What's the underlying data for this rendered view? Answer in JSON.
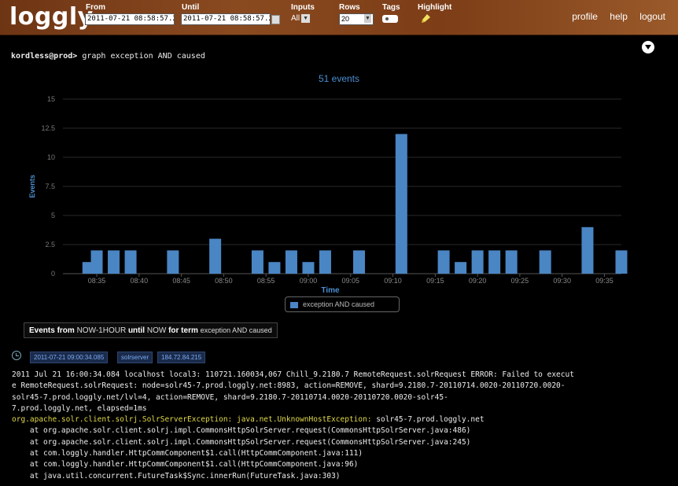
{
  "header": {
    "logo": "loggly",
    "from_label": "From",
    "from_value": "2011-07-21 08:58:57.22",
    "until_label": "Until",
    "until_value": "2011-07-21 08:58:57.22",
    "inputs_label": "Inputs",
    "inputs_value": "All",
    "rows_label": "Rows",
    "rows_value": "20",
    "tags_label": "Tags",
    "highlight_label": "Highlight",
    "links": [
      "profile",
      "help",
      "logout"
    ]
  },
  "console": {
    "prompt_user": "kordless@prod>",
    "command": "graph exception AND caused"
  },
  "chart_data": {
    "type": "bar",
    "title": "51 events",
    "xlabel": "Time",
    "ylabel": "Events",
    "ylim": [
      0,
      15
    ],
    "yticks": [
      "0",
      "2.5",
      "5",
      "7.5",
      "10",
      "12.5",
      "15"
    ],
    "xticks": [
      "08:35",
      "08:40",
      "08:45",
      "08:50",
      "08:55",
      "09:00",
      "09:05",
      "09:10",
      "09:15",
      "09:20",
      "09:25",
      "09:30",
      "09:35"
    ],
    "x_minutes": [
      34,
      35,
      36,
      37,
      39,
      41,
      43,
      44,
      45,
      46,
      47,
      49,
      52,
      53,
      55,
      56,
      57,
      59,
      60,
      61,
      62,
      63,
      65,
      67,
      68
    ],
    "values": [
      1,
      2,
      2,
      2,
      2,
      3,
      2,
      1,
      2,
      1,
      2,
      2,
      12,
      2,
      1,
      2,
      2,
      2,
      2,
      4,
      2,
      0,
      0,
      0,
      0
    ],
    "bars": [
      {
        "time": "08:34",
        "value": 1
      },
      {
        "time": "08:35",
        "value": 2
      },
      {
        "time": "08:37",
        "value": 2
      },
      {
        "time": "08:39",
        "value": 2
      },
      {
        "time": "08:44",
        "value": 2
      },
      {
        "time": "08:49",
        "value": 3
      },
      {
        "time": "08:54",
        "value": 2
      },
      {
        "time": "08:56",
        "value": 1
      },
      {
        "time": "08:58",
        "value": 2
      },
      {
        "time": "09:00",
        "value": 1
      },
      {
        "time": "09:02",
        "value": 2
      },
      {
        "time": "09:06",
        "value": 2
      },
      {
        "time": "09:11",
        "value": 12
      },
      {
        "time": "09:16",
        "value": 2
      },
      {
        "time": "09:18",
        "value": 1
      },
      {
        "time": "09:20",
        "value": 2
      },
      {
        "time": "09:22",
        "value": 2
      },
      {
        "time": "09:24",
        "value": 2
      },
      {
        "time": "09:28",
        "value": 2
      },
      {
        "time": "09:33",
        "value": 4
      },
      {
        "time": "09:37",
        "value": 2
      }
    ],
    "legend": "exception AND caused",
    "color": "#4a85c4",
    "grid": true
  },
  "summary": {
    "p1": "Events from",
    "p2": "NOW-1HOUR",
    "p3": "until",
    "p4": "NOW",
    "p5": "for term",
    "p6": "exception AND caused"
  },
  "event": {
    "timestamp": "2011-07-21 09:00:34.085",
    "source": "solrserver",
    "ip": "184.72.84.215",
    "lines": [
      "2011 Jul 21 16:00:34.084 localhost local3: 110721.160034,067 Chill_9.2180.7 RemoteRequest.solrRequest ERROR: Failed to execut",
      "e RemoteRequest.solrRequest: node=solr45-7.prod.loggly.net:8983, action=REMOVE, shard=9.2180.7-20110714.0020-20110720.0020-",
      "solr45-7.prod.loggly.net/lvl=4, action=REMOVE, shard=9.2180.7-20110714.0020-20110720.0020-solr45-",
      "7.prod.loggly.net, elapsed=1ms"
    ],
    "exception_line": "org.apache.solr.client.solrj.SolrServerException: java.net.UnknownHostException:",
    "exception_host": " solr45-7.prod.loggly.net",
    "stack": [
      "    at org.apache.solr.client.solrj.impl.CommonsHttpSolrServer.request(CommonsHttpSolrServer.java:486)",
      "    at org.apache.solr.client.solrj.impl.CommonsHttpSolrServer.request(CommonsHttpSolrServer.java:245)",
      "    at com.loggly.handler.HttpCommComponent$1.call(HttpCommComponent.java:111)",
      "    at com.loggly.handler.HttpCommComponent$1.call(HttpCommComponent.java:96)",
      "    at java.util.concurrent.FutureTask$Sync.innerRun(FutureTask.java:303)"
    ]
  }
}
